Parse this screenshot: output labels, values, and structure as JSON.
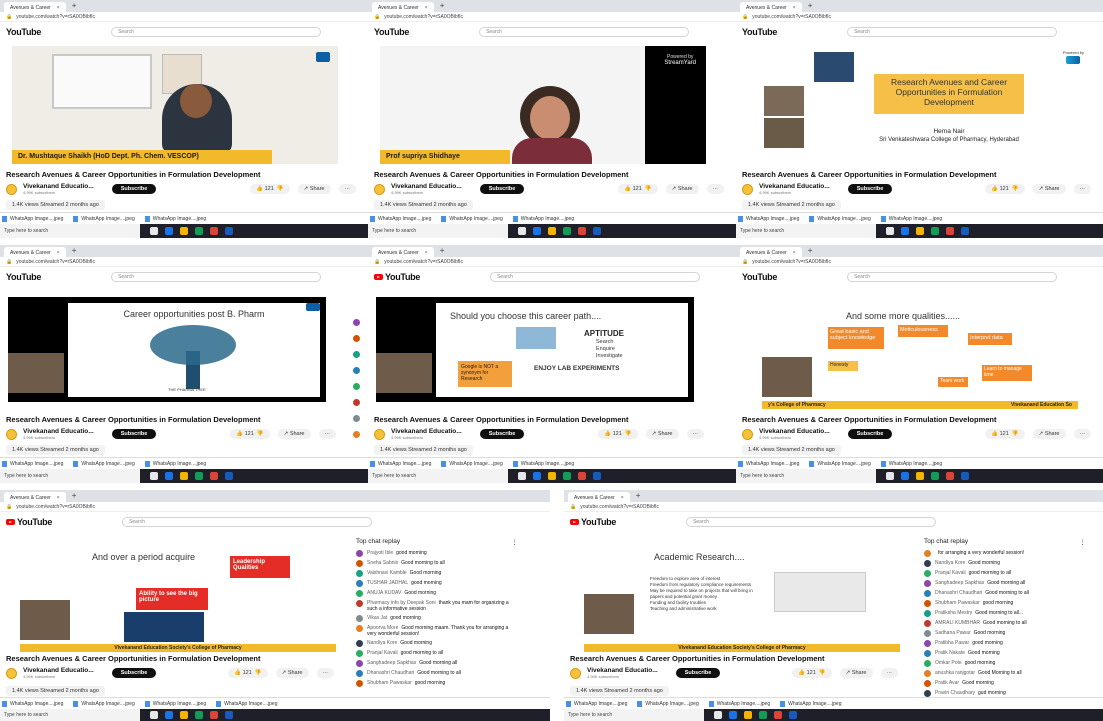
{
  "browser": {
    "tab_title": "Avenues & Career",
    "tab_close": "×",
    "new_tab": "+",
    "url": "youtube.com/watch?v=rSA0OBibfIc"
  },
  "youtube": {
    "logo_text": "YouTube",
    "search_placeholder": "Search"
  },
  "video": {
    "title": "Research Avenues & Career Opportunities in Formulation Development",
    "channel": "Vivekanand Educatio...",
    "subscribers": "4.99K subscribers",
    "subscribe": "Subscribe",
    "likes": "121",
    "share": "Share",
    "more": "···",
    "views": "1.4K views  Streamed 2 months ago"
  },
  "downloads": [
    "WhatsApp Image....jpeg",
    "WhatsApp Image....jpeg",
    "WhatsApp Image....jpeg",
    "WhatsApp Image....jpeg"
  ],
  "taskbar": {
    "search": "Type here to search"
  },
  "panels": [
    {
      "slide_caption": "Dr. Mushtaque Shaikh (HoD Dept. Ph. Chem. VESCOP)"
    },
    {
      "slide_caption": "Prof supriya Shidhaye",
      "powered": "Powered by",
      "brand": "StreamYard"
    },
    {
      "slide_title": "Research Avenues and Career Opportunities in Formulation Development",
      "presenter": "Hema Nair",
      "college": "Sri Venkateshwara College of Pharmacy, Hyderabad",
      "powered": "Powered by"
    },
    {
      "slide_title": "Career opportunities post B. Pharm",
      "tree_label": "THE PHARMA TREE"
    },
    {
      "slide_title": "Should you choose this career path....",
      "aptitude": "APTITUDE",
      "aptitude_items": [
        "Search",
        "Enquire",
        "Investigate"
      ],
      "google_note": "Google is NOT a synonym for Research",
      "enjoy": "ENJOY LAB EXPERIMENTS"
    },
    {
      "slide_title": "And some more qualities......",
      "q1": "Great basic and subject knowledge",
      "q2": "Meticulousness",
      "q3": "Interpret data",
      "q4": "Honesty",
      "q5": "Team work",
      "q6": "Learn to manage time",
      "footer_left": "y's College of Pharmacy",
      "footer_right": "Vivekanand Education So"
    },
    {
      "slide_title": "And over a period acquire",
      "q1": "Leadership Qualities",
      "q2": "Ability to see the big picture",
      "footer": "Vivekanand Education Society's College of Pharmacy"
    },
    {
      "slide_title": "Academic Research....",
      "points": [
        "Freedom to explore area of interest",
        "Freedom from regulatory compliance requirements",
        "May be required to take on projects that will bring in papers and potential grant money",
        "Funding and facility troubles",
        "Teaching and administrative work"
      ],
      "footer": "Vivekanand Education Society's College of Pharmacy"
    }
  ],
  "chat_replay": {
    "header": "Top chat replay",
    "left": [
      {
        "author": "Prajyoti Ible",
        "message": "good morning",
        "color": "#8e44ad"
      },
      {
        "author": "Sneha Sabnis",
        "message": "Good morning to all",
        "color": "#d35400"
      },
      {
        "author": "Vaishnavi Kamble",
        "message": "Good morning",
        "color": "#16a085"
      },
      {
        "author": "TUSHAR JADHAL",
        "message": "good morning",
        "color": "#2980b9"
      },
      {
        "author": "ANUJA KUDAV",
        "message": "Good morning",
        "color": "#27ae60"
      },
      {
        "author": "Pharmacy info by Deepak Soni",
        "message": "thank you mam for organizing a such a informative session",
        "color": "#c0392b"
      },
      {
        "author": "Vikas Jat",
        "message": "good morning",
        "color": "#7f8c8d"
      },
      {
        "author": "Apoorva More",
        "message": "Good morning maam. Thank you for arranging a very wonderful session!",
        "color": "#e67e22"
      },
      {
        "author": "Nandiya Kore",
        "message": "Good morning",
        "color": "#2c3e50"
      },
      {
        "author": "Pranjal Kavali",
        "message": "good morning to all",
        "color": "#27ae60"
      },
      {
        "author": "Sanghadeep Sapkhas",
        "message": "Good morning all",
        "color": "#8e44ad"
      },
      {
        "author": "Dhanashri Chaudhari",
        "message": "Good morning to all",
        "color": "#2980b9"
      },
      {
        "author": "Shubham Pawaskar",
        "message": "good morning",
        "color": "#d35400"
      }
    ],
    "right": [
      {
        "author": "",
        "message": "for arranging a very wonderful session!",
        "color": "#e67e22"
      },
      {
        "author": "Nandiya Kore",
        "message": "Good morning",
        "color": "#2c3e50"
      },
      {
        "author": "Pranjal Kavali",
        "message": "good morning to all",
        "color": "#27ae60"
      },
      {
        "author": "Sanghadeep Sapkhas",
        "message": "Good morning all",
        "color": "#8e44ad"
      },
      {
        "author": "Dhanashri Chaudhari",
        "message": "Good morning to all",
        "color": "#2980b9"
      },
      {
        "author": "Shubham Pawaskar",
        "message": "good morning",
        "color": "#d35400"
      },
      {
        "author": "Pratiksha Mestry",
        "message": "Good morning to all...",
        "color": "#16a085"
      },
      {
        "author": "AMRALI KUMBHAR",
        "message": "Good morning to all",
        "color": "#c0392b"
      },
      {
        "author": "Sadhana Pawar",
        "message": "Good morning",
        "color": "#7f8c8d"
      },
      {
        "author": "Pratibha Pawar",
        "message": "good morning",
        "color": "#8e44ad"
      },
      {
        "author": "Pratik Nakate",
        "message": "Good morning",
        "color": "#2980b9"
      },
      {
        "author": "Omkar Pote",
        "message": "good morning",
        "color": "#27ae60"
      },
      {
        "author": "anushka ranjgotar",
        "message": "Good Morning to all",
        "color": "#e67e22"
      },
      {
        "author": "Pratik Avar",
        "message": "Good morning",
        "color": "#d35400"
      },
      {
        "author": "Pravin Chaudhary",
        "message": "gud morning",
        "color": "#2c3e50"
      }
    ]
  }
}
